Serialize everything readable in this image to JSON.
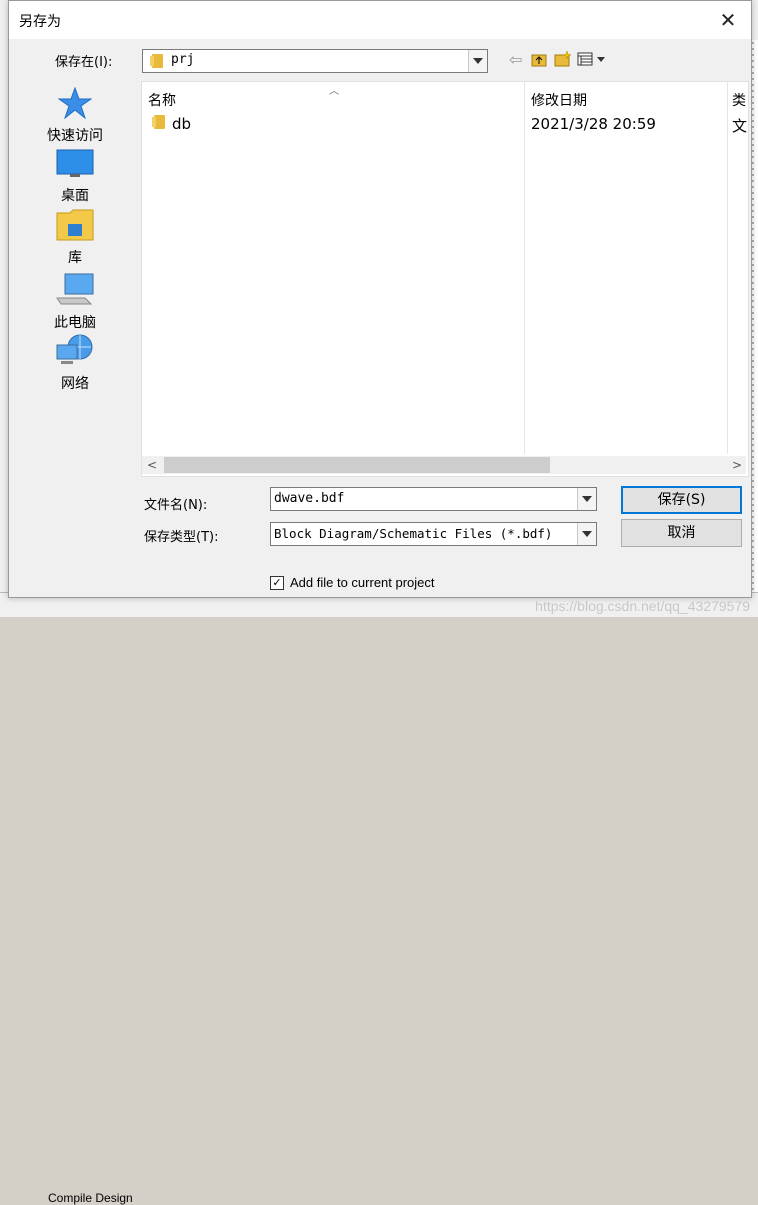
{
  "dialog": {
    "title": "另存为",
    "close_glyph": "✕"
  },
  "location": {
    "label": "保存在(I):",
    "value": "prj"
  },
  "toolbar": {
    "back_glyph": "⇦"
  },
  "places": [
    {
      "label": "快速访问",
      "icon": "star-icon"
    },
    {
      "label": "桌面",
      "icon": "desktop-icon"
    },
    {
      "label": "库",
      "icon": "library-icon"
    },
    {
      "label": "此电脑",
      "icon": "computer-icon"
    },
    {
      "label": "网络",
      "icon": "network-icon"
    }
  ],
  "list": {
    "columns": [
      "名称",
      "修改日期",
      "类"
    ],
    "rows": [
      {
        "name": "db",
        "date": "2021/3/28 20:59",
        "type": "文"
      }
    ]
  },
  "filename": {
    "label": "文件名(N):",
    "value": "dwave.bdf"
  },
  "filetype": {
    "label": "保存类型(T):",
    "value": "Block Diagram/Schematic Files (*.bdf)"
  },
  "buttons": {
    "save": "保存(S)",
    "cancel": "取消"
  },
  "add_to_project": {
    "label": "Add file to current project",
    "checked": true,
    "glyph": "✓"
  },
  "background": {
    "compile_label": "Compile Design"
  },
  "watermark": "https://blog.csdn.net/qq_43279579"
}
